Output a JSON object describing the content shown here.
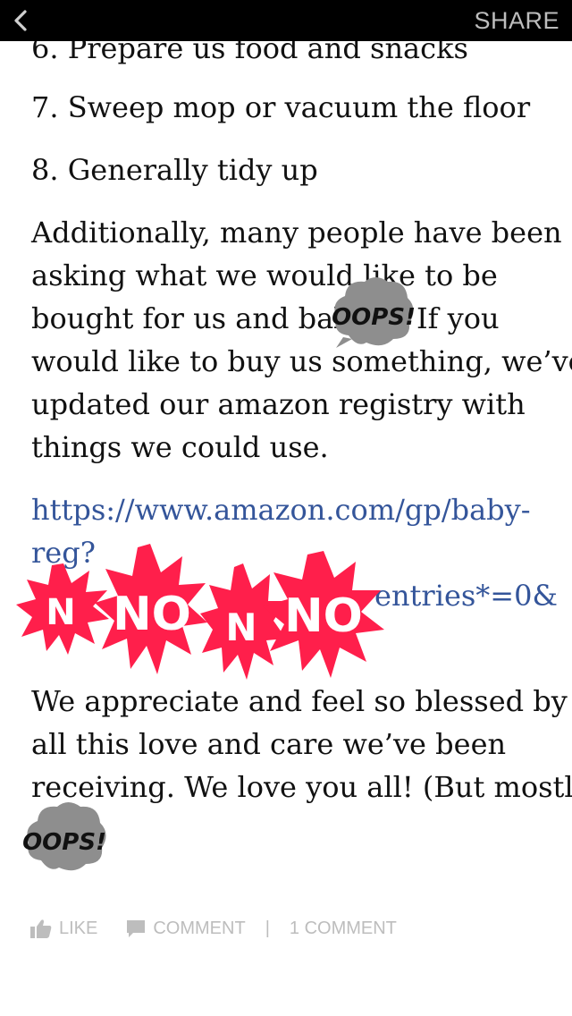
{
  "header": {
    "back_icon": "chevron-left-icon",
    "share_label": "SHARE"
  },
  "article": {
    "list_item_6_partial": "6. Prepare us food and snacks",
    "list_item_7": "7. Sweep mop or vacuum the floor",
    "list_item_8": "8. Generally tidy up",
    "paragraph_1_lines": [
      "Additionally, many people have been",
      "asking what we would like to be",
      "bought for us and baby",
      "If you",
      "would like to buy us something, we’ve",
      "updated our amazon registry with",
      "things we could use."
    ],
    "link_lines": [
      "https://www.amazon.com/gp/baby-",
      "reg?",
      "entries*=0&"
    ],
    "paragraph_2_lines": [
      "We appreciate and feel so blessed by",
      "all this love and care we’ve been",
      "receiving. We love you all! (But mostly"
    ]
  },
  "stickers": {
    "oops_text": "OOPS!",
    "no_text": "NO",
    "no_partial_text": "N"
  },
  "colors": {
    "link": "#34559a",
    "no_sticker": "#ff1f4b",
    "oops_cloud": "#8e8e8e",
    "footer_text": "#bdbdbd"
  },
  "footer": {
    "like_label": "LIKE",
    "comment_label": "COMMENT",
    "separator": "|",
    "comment_count_label": "1 COMMENT"
  }
}
